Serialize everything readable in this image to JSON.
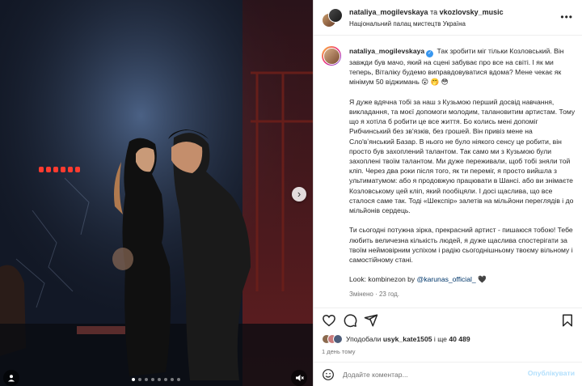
{
  "post": {
    "collab_author_1": "nataliya_mogilevskaya",
    "collab_conjunction": "та",
    "collab_author_2": "vkozlovsky_music",
    "location": "Національний палац мистецтв Україна",
    "more_icon": "more-horizontal-icon"
  },
  "media": {
    "description_icons": [
      "next-arrow-icon",
      "user-tag-icon",
      "mute-icon"
    ],
    "next_glyph": "›",
    "slide_count": 8,
    "active_slide": 1,
    "colors": {
      "stage_red": "#e23b2e",
      "backdrop_blue": "#2b3b56",
      "floor": "#0b0e16"
    }
  },
  "caption": {
    "username": "nataliya_mogilevskaya",
    "p1": "Так зробити міг тільки Козловський. Він завжди був мачо, який на сцені забуває про все на світі. І як ми теперь, Віталіку будемо виправдовуватися вдома? Мене чекає як мінімум 50 віджимань 😮 🤭 😳",
    "p2": "Я дуже вдячна тобі за наш з Кузьмою перший досвід навчання, викладання, та моєї допомоги молодим, талановитим артистам. Тому що я хотіла б робити це все життя. Бо колись мені допоміг Рибчинський без зв'язків, без грошей. Він привіз мене на Сло'вʼянський Базар. В нього не було ніякого сенсу це робити, він просто був захоплений талантом. Так само ми з Кузьмою були захоплені твоїм талантом. Ми дуже переживали, щоб тобі зняли той кліп. Через два роки після того, як ти переміг, я просто вийшла з ультиматумом: або я продовжую працювати в Шансі. або ви знімаєте Козловському цей кліп, який пообіцяли. І досі щаслива, що все сталося саме так. Тоді «Шекспір» залетів на мільйони переглядів і до мільйонів сердець.",
    "p3": "Ти сьогодні потужна зірка, прекрасний артист - пишаюся тобою! Тебе любить величезна кількість людей, я дуже щаслива спостерігати за твоїм неймовірним успіхом і радію сьогоднішньому твоєму вільному і самостійному стані.",
    "look_prefix": "Look: kombinezon by",
    "look_mention": "@karunas_official_",
    "look_heart": "🖤",
    "edited": "Змінено · 23 год."
  },
  "actions": {
    "icons": [
      "heart-icon",
      "comment-icon",
      "share-icon",
      "bookmark-icon"
    ]
  },
  "likes": {
    "prefix": "Уподобали",
    "user": "usyk_kate1505",
    "middle": "і ще",
    "count": "40 489"
  },
  "timestamp": "1 день тому",
  "comment": {
    "placeholder": "Додайте коментар...",
    "post_label": "Опублікувати"
  }
}
